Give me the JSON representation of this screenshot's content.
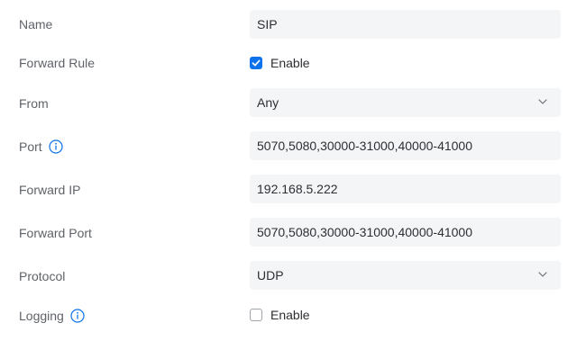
{
  "form": {
    "name": {
      "label": "Name",
      "value": "SIP"
    },
    "forward_rule": {
      "label": "Forward Rule",
      "checkbox_label": "Enable",
      "checked": true
    },
    "from": {
      "label": "From",
      "value": "Any"
    },
    "port": {
      "label": "Port",
      "value": "5070,5080,30000-31000,40000-41000",
      "icon": "info-icon"
    },
    "forward_ip": {
      "label": "Forward IP",
      "value": "192.168.5.222"
    },
    "forward_port": {
      "label": "Forward Port",
      "value": "5070,5080,30000-31000,40000-41000"
    },
    "protocol": {
      "label": "Protocol",
      "value": "UDP"
    },
    "logging": {
      "label": "Logging",
      "checkbox_label": "Enable",
      "checked": false,
      "icon": "info-icon"
    }
  },
  "colors": {
    "accent": "#0e72ed",
    "label_text": "#5f6368",
    "field_bg": "#f4f5f7",
    "field_text": "#2e2e33"
  }
}
